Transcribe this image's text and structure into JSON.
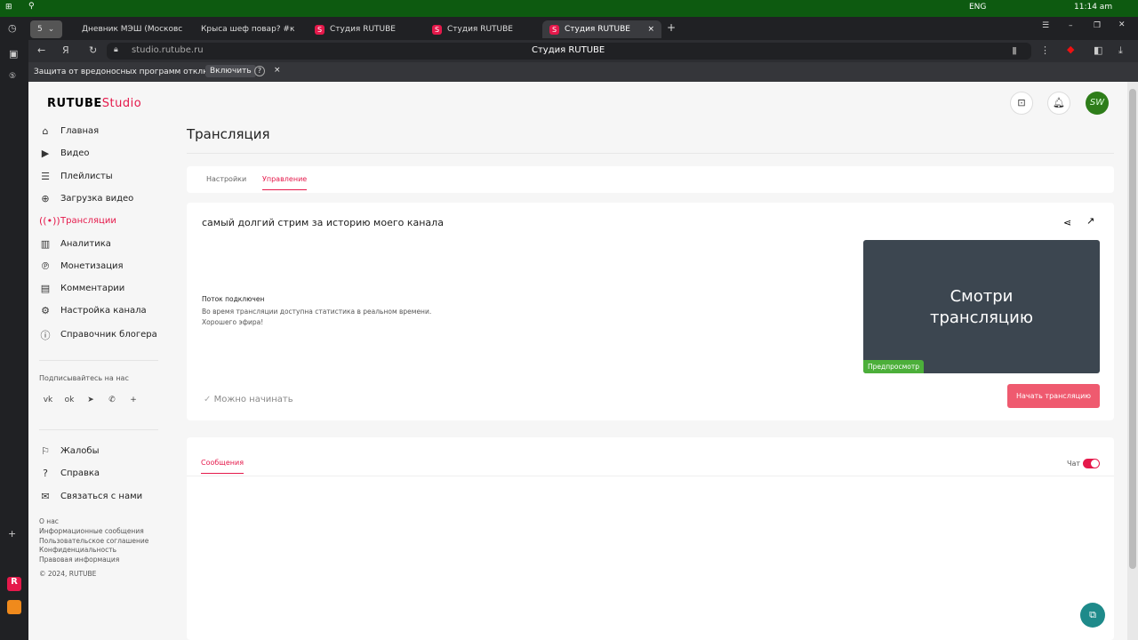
{
  "taskbar": {
    "lang": "ENG",
    "time": "11:14 am"
  },
  "browser": {
    "tabs": [
      {
        "label": "Дневник МЭШ (Московс"
      },
      {
        "label": "Крыса шеф повар? #к"
      },
      {
        "label": "Студия RUTUBE"
      },
      {
        "label": "Студия RUTUBE"
      },
      {
        "label": "Студия RUTUBE"
      }
    ],
    "tab_counter": "5",
    "url": "studio.rutube.ru",
    "page_title": "Студия RUTUBE",
    "infobar": {
      "text": "Защита от вредоносных программ отключена",
      "button": "Включить",
      "help": "?",
      "close": "×"
    }
  },
  "logo": {
    "text": "RUTUBE",
    "suffix": "Studio"
  },
  "sidebar": {
    "items": [
      {
        "label": "Главная",
        "icon": "⌂"
      },
      {
        "label": "Видео",
        "icon": "▶"
      },
      {
        "label": "Плейлисты",
        "icon": "☰"
      },
      {
        "label": "Загрузка видео",
        "icon": "⊕"
      },
      {
        "label": "Трансляции",
        "icon": "((•))",
        "active": true
      },
      {
        "label": "Аналитика",
        "icon": "▥"
      },
      {
        "label": "Монетизация",
        "icon": "℗"
      },
      {
        "label": "Комментарии",
        "icon": "▤"
      },
      {
        "label": "Настройка канала",
        "icon": "⚙"
      },
      {
        "label": "Справочник блогера",
        "icon": "ⓘ"
      }
    ],
    "subscribe_label": "Подписывайтесь на нас",
    "socials": [
      "vk",
      "ok",
      "➤",
      "✆",
      "+"
    ],
    "bottom_items": [
      {
        "label": "Жалобы",
        "icon": "⚐"
      },
      {
        "label": "Справка",
        "icon": "?"
      },
      {
        "label": "Связаться с нами",
        "icon": "✉"
      }
    ],
    "footer_links": [
      "О нас",
      "Информационные сообщения",
      "Пользовательское соглашение",
      "Конфиденциальность",
      "Правовая информация"
    ],
    "copyright": "© 2024, RUTUBE"
  },
  "header": {
    "avatar": "SW"
  },
  "main": {
    "title": "Трансляция",
    "tabs": [
      {
        "label": "Настройки"
      },
      {
        "label": "Управление",
        "active": true
      }
    ],
    "stream_title": "самый долгий стрим за историю моего канала",
    "status_title": "Поток подключен",
    "status_line1": "Во время трансляции доступна статистика в реальном времени.",
    "status_line2": "Хорошего эфира!",
    "ready": "Можно начинать",
    "preview_text": "Смотри трансляцию",
    "preview_badge": "Предпросмотр",
    "start_button": "Начать трансляцию",
    "messages_tab": "Сообщения",
    "chat_label": "Чат",
    "chat_enabled": true
  },
  "colors": {
    "accent": "#e5194b",
    "button": "#ef5a6f",
    "preview_bg": "#3c4650",
    "badge": "#4caf3a"
  }
}
